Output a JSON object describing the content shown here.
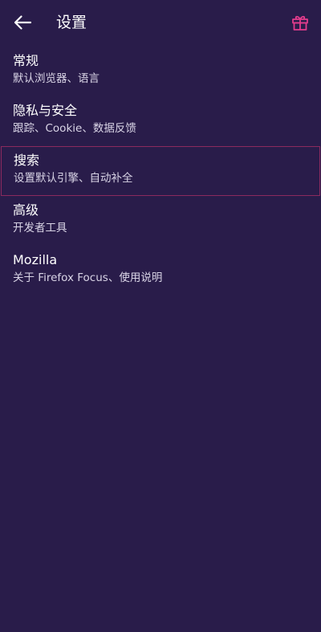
{
  "header": {
    "title": "设置",
    "back_icon": "arrow-left-icon",
    "gift_icon": "gift-icon",
    "accent_color": "#e23c8c"
  },
  "settings": {
    "items": [
      {
        "title": "常规",
        "subtitle": "默认浏览器、语言"
      },
      {
        "title": "隐私与安全",
        "subtitle": "跟踪、Cookie、数据反馈"
      },
      {
        "title": "搜索",
        "subtitle": "设置默认引擎、自动补全"
      },
      {
        "title": "高级",
        "subtitle": "开发者工具"
      },
      {
        "title": "Mozilla",
        "subtitle": "关于 Firefox Focus、使用说明"
      }
    ]
  },
  "colors": {
    "background": "#291c4a",
    "focus_border": "#8c2a5e"
  }
}
